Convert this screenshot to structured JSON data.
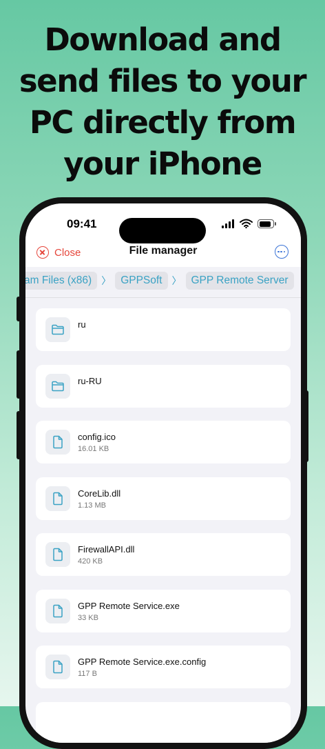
{
  "headline": {
    "line1": "Download and",
    "line2": "send files to your",
    "line3": "PC directly from",
    "line4": "your iPhone"
  },
  "status_bar": {
    "time": "09:41"
  },
  "nav": {
    "close_label": "Close",
    "title": "File manager"
  },
  "breadcrumbs": [
    {
      "label": "am Files (x86)"
    },
    {
      "label": "GPPSoft"
    },
    {
      "label": "GPP Remote Server"
    }
  ],
  "files": [
    {
      "name": "ru",
      "size": "",
      "type": "folder"
    },
    {
      "name": "ru-RU",
      "size": "",
      "type": "folder"
    },
    {
      "name": "config.ico",
      "size": "16.01 KB",
      "type": "file"
    },
    {
      "name": "CoreLib.dll",
      "size": "1.13 MB",
      "type": "file"
    },
    {
      "name": "FirewallAPI.dll",
      "size": "420 KB",
      "type": "file"
    },
    {
      "name": "GPP Remote Service.exe",
      "size": "33 KB",
      "type": "file"
    },
    {
      "name": "GPP Remote Service.exe.config",
      "size": "117 B",
      "type": "file"
    }
  ],
  "colors": {
    "accent_close": "#e5453a",
    "accent_more": "#3a73d6",
    "accent_crumb": "#3aa2c4",
    "background_green": "#66c8a3"
  }
}
